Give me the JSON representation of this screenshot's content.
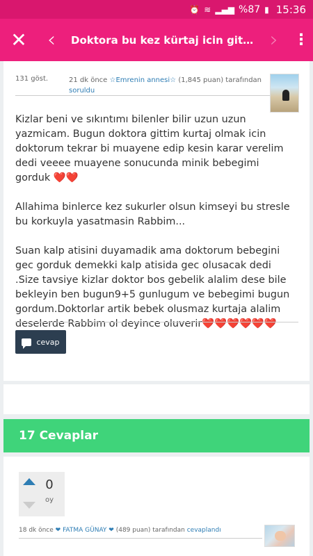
{
  "status_bar": {
    "icons": [
      "alarm-icon",
      "wifi-icon",
      "signal-icon",
      "battery-icon"
    ],
    "battery": "%87",
    "time": "15:36"
  },
  "app_bar": {
    "title": "Doktora bu kez kürtaj icin gitmisti...",
    "color": "#ed1f7c"
  },
  "question": {
    "views": "131 göst.",
    "time_ago": "21 dk önce",
    "user": "☆Emrenin annesi☆",
    "points": "(1,845 puan)",
    "by_text": "tarafından",
    "asked_label": "soruldu",
    "paragraphs": [
      "Kizlar beni ve sıkıntımı bilenler bilir uzun uzun yazmicam. Bugun doktora gittim kurtaj olmak icin doktorum tekrar bi muayene edip kesin karar verelim dedi veeee muayene sonucunda minik bebegimi gorduk ❤️❤️",
      "Allahima binlerce kez sukurler olsun kimseyi bu stresle bu korkuyla yasatmasin Rabbim...",
      "Suan kalp atisini duyamadik ama doktorum bebegini gec gorduk demekki kalp atisida gec olusacak dedi .Size tavsiye kizlar doktor bos gebelik alalim dese bile bekleyin ben bugun9+5 gunlugum ve bebegimi bugun gordum.Doktorlar artik bebek olusmaz kurtaja alalim deselerde  Rabbim ol deyince oluverir❤️❤️❤️❤️❤️❤️"
    ],
    "reply_label": "cevap"
  },
  "answers": {
    "header": "17 Cevaplar",
    "color": "#3fd47a",
    "items": [
      {
        "votes": "0",
        "vote_unit": "oy",
        "time_ago": "18 dk önce",
        "user": "❤ FATMA GÜNAY ❤",
        "points": "(489 puan)",
        "by_text": "tarafından",
        "answered_label": "cevaplandı"
      }
    ]
  }
}
